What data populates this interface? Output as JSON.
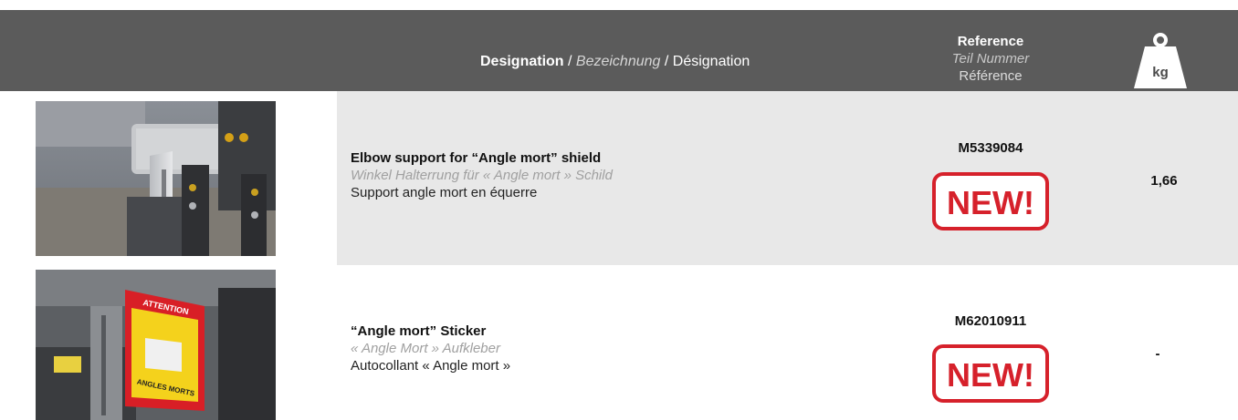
{
  "header": {
    "designation_en": "Designation",
    "sep1": " / ",
    "designation_de": "Bezeichnung",
    "sep2": " / ",
    "designation_fr": "Désignation",
    "reference_en": "Reference",
    "reference_de": "Teil Nummer",
    "reference_fr": "Référence",
    "weight_unit": "kg",
    "weight_icon": "weight-kg-icon",
    "background_color": "#5b5b5b"
  },
  "items": [
    {
      "name_en": "Elbow support for “Angle mort” shield",
      "name_de": "Winkel Halterrung für « Angle mort » Schild",
      "name_fr": "Support angle mort en équerre",
      "reference": "M5339084",
      "badge": "NEW!",
      "weight": "1,66",
      "photo_icon": "elbow-support-photo"
    },
    {
      "name_en": "“Angle mort” Sticker",
      "name_de": "« Angle Mort » Aufkleber",
      "name_fr": "Autocollant « Angle mort »",
      "reference": "M62010911",
      "badge": "NEW!",
      "weight": "-",
      "photo_icon": "sticker-photo",
      "sticker_text_top": "ATTENTION",
      "sticker_text_bottom": "ANGLES MORTS"
    }
  ],
  "colors": {
    "badge_red": "#d6212b",
    "row_shade": "#e8e8e8"
  }
}
